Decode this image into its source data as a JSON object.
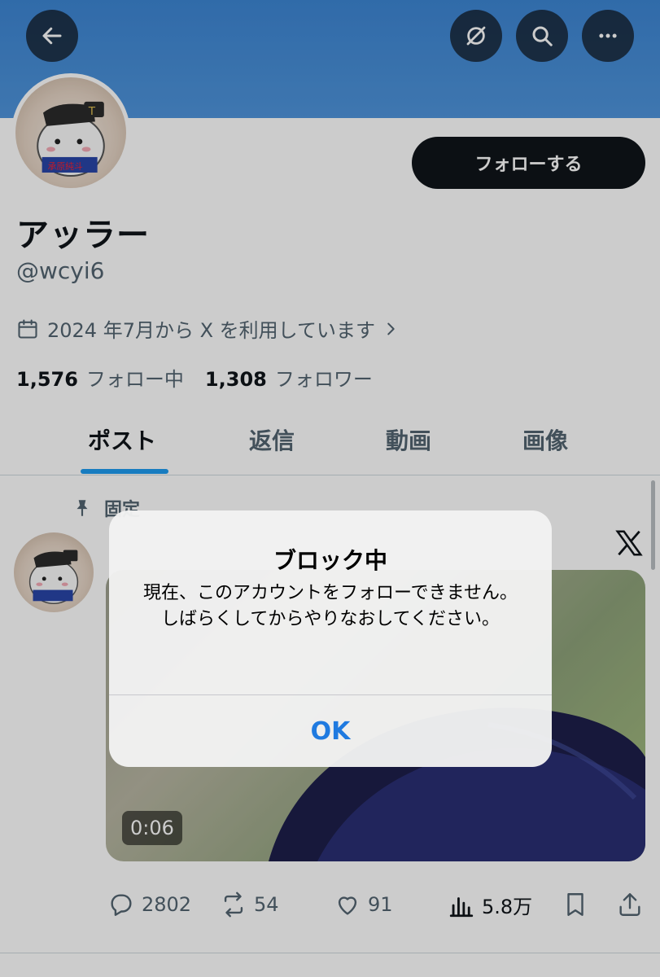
{
  "header": {
    "back_icon": "arrow-left-icon",
    "grok_icon": "grok-icon",
    "search_icon": "search-icon",
    "more_icon": "ellipsis-icon",
    "banner_color": "#4a90d9"
  },
  "profile": {
    "follow_label": "フォローする",
    "display_name": "アッラー",
    "handle": "@wcyi6",
    "joined": "2024 年7月から X を利用しています",
    "following_count": "1,576",
    "following_label": "フォロー中",
    "followers_count": "1,308",
    "followers_label": "フォロワー"
  },
  "tabs": [
    {
      "label": "ポスト",
      "active": true
    },
    {
      "label": "返信",
      "active": false
    },
    {
      "label": "動画",
      "active": false
    },
    {
      "label": "画像",
      "active": false
    }
  ],
  "post": {
    "pinned_label": "固定",
    "video_duration": "0:06",
    "replies": "2802",
    "reposts": "54",
    "likes": "91",
    "views": "5.8万"
  },
  "dialog": {
    "title": "ブロック中",
    "message": "現在、このアカウントをフォローできません。しばらくしてからやりなおしてください。",
    "ok_label": "OK"
  },
  "colors": {
    "accent": "#1d9bf0",
    "dialog_button": "#1f7ae0"
  }
}
